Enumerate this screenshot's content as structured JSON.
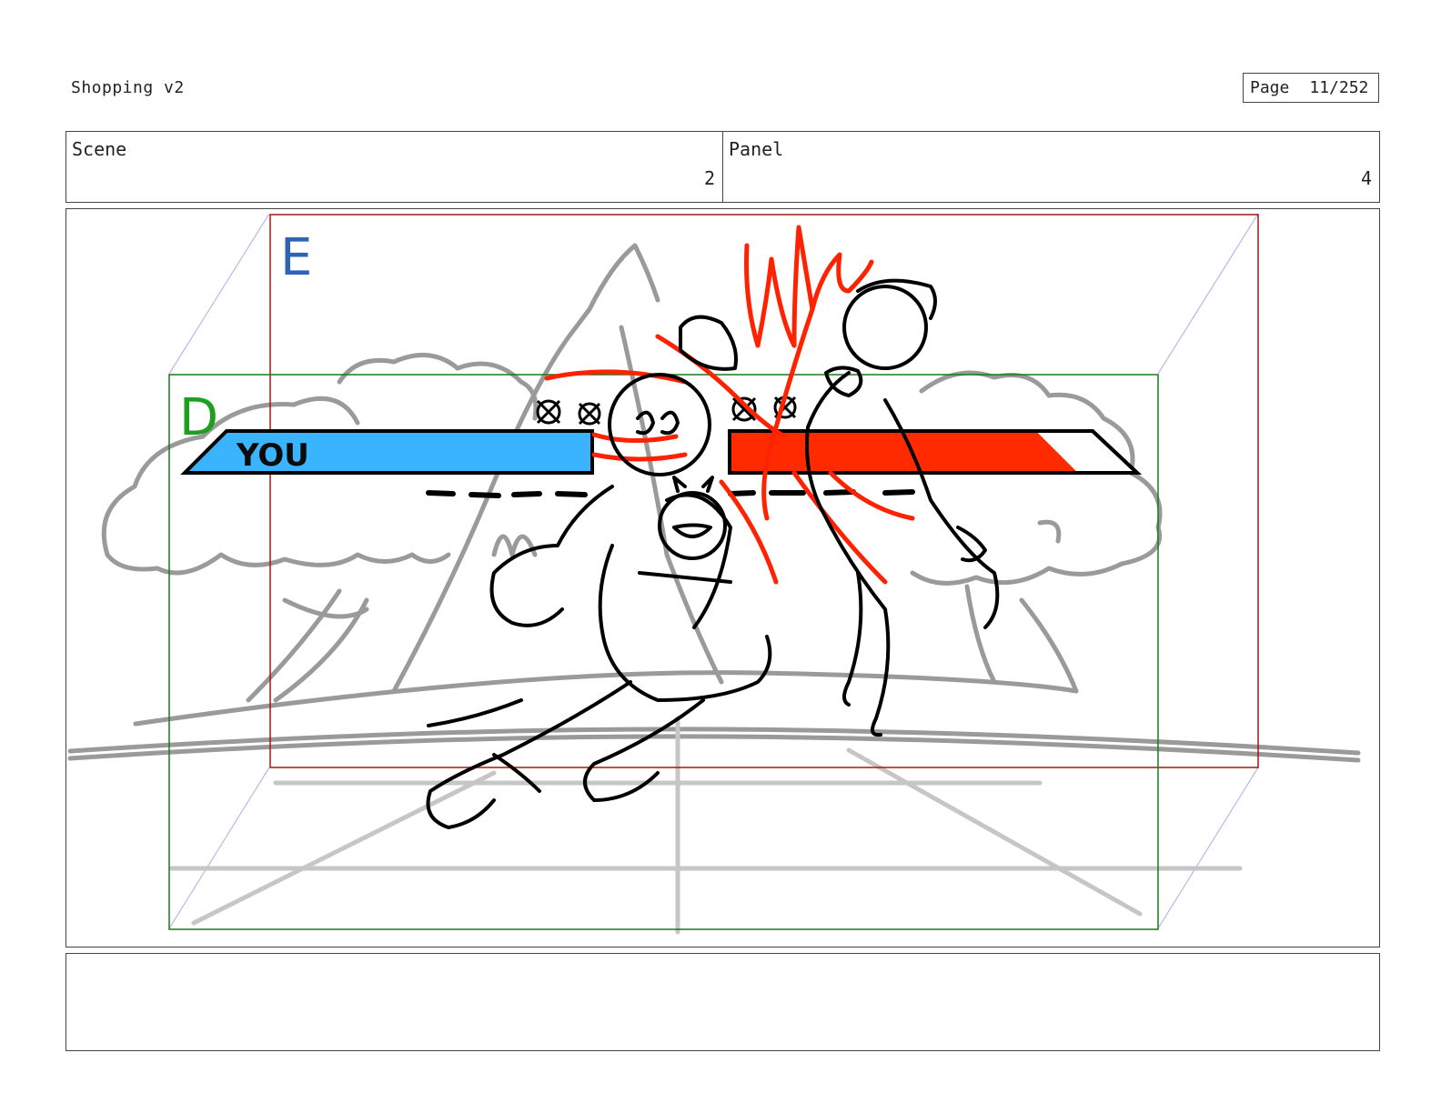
{
  "document": {
    "title": "Shopping v2"
  },
  "page": {
    "label": "Page",
    "value": "11/252"
  },
  "header": {
    "scene": {
      "label": "Scene",
      "value": "2"
    },
    "panel": {
      "label": "Panel",
      "value": "4"
    }
  },
  "frames": {
    "outer": {
      "letter": "E",
      "color": "#2e64b5"
    },
    "inner": {
      "letter": "D",
      "color": "#1f9e1f"
    }
  },
  "hud": {
    "player_label": "YOU",
    "player_bar_color": "#3ab4ff",
    "player_health": 1.0,
    "enemy_bar_color": "#ff2a00",
    "enemy_health": 0.85
  },
  "notes": {
    "text": ""
  }
}
